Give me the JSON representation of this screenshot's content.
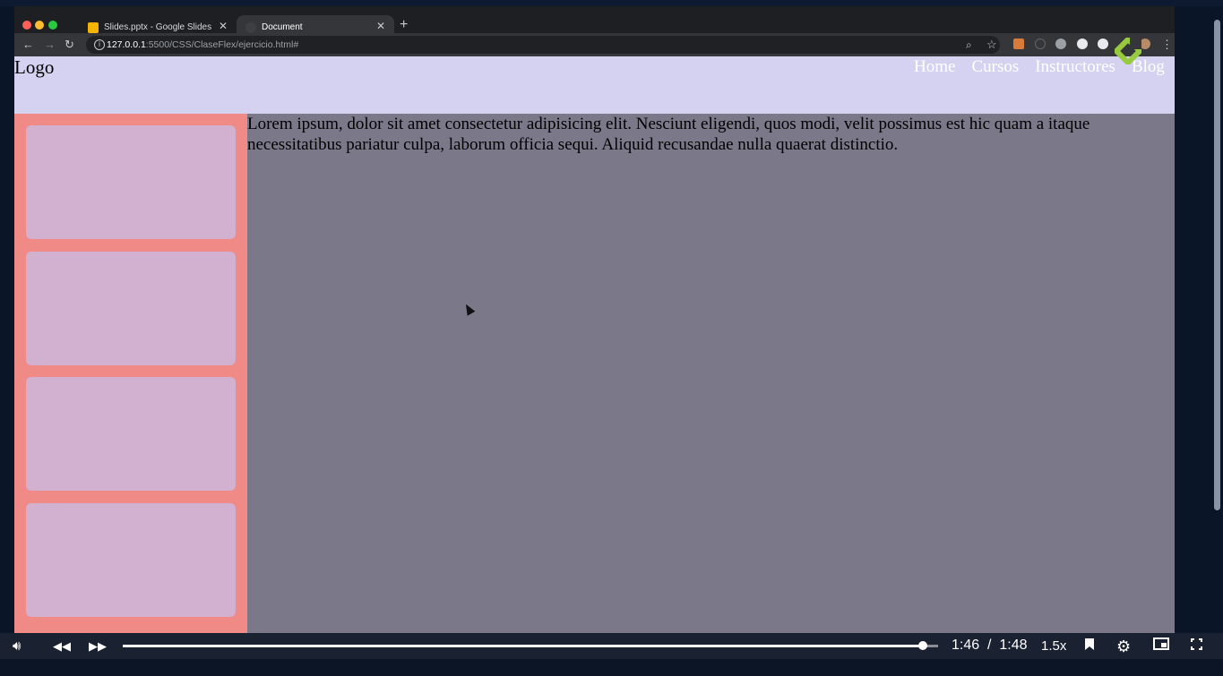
{
  "browser": {
    "tabs": [
      {
        "label": "Slides.pptx - Google Slides",
        "favicon_color": "#f4b400",
        "active": false
      },
      {
        "label": "Document",
        "favicon_color": "#5f6368",
        "active": true
      }
    ],
    "url_host": "127.0.0.1",
    "url_path": ":5500/CSS/ClaseFlex/ejercicio.html#"
  },
  "site": {
    "logo": "Logo",
    "nav": [
      "Home",
      "Cursos",
      "Instructores",
      "Blog"
    ],
    "content": "Lorem ipsum, dolor sit amet consectetur adipisicing elit. Nesciunt eligendi, quos modi, velit possimus est hic quam a itaque necessitatibus pariatur culpa, laborum officia sequi. Aliquid recusandae nulla quaerat distinctio.",
    "sidebar_cards": 4,
    "colors": {
      "header": "#d4d1f1",
      "sidebar": "#ef8a86",
      "card": "#d1b0d0",
      "main": "#7a7889"
    }
  },
  "video": {
    "current_time": "1:46",
    "duration": "1:48",
    "separator": "/",
    "speed": "1.5x",
    "progress": 0.981
  }
}
